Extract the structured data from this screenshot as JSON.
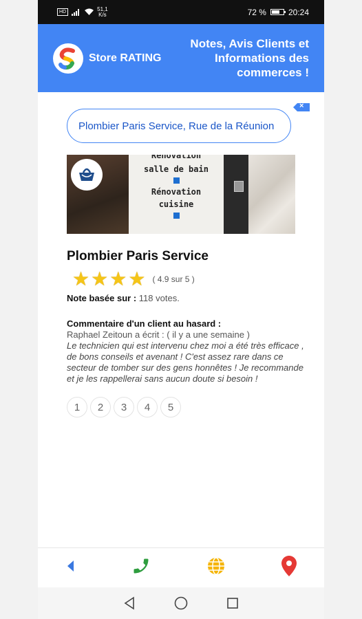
{
  "status_bar": {
    "network_badge": "HD",
    "net_speed_value": "51,1",
    "net_speed_unit": "K/s",
    "battery_percent": "72 %",
    "battery_level": 0.72,
    "time": "20:24"
  },
  "header": {
    "brand_prefix": "Store ",
    "brand_bold": "RATING",
    "tagline": "Notes, Avis Clients et Informations des commerces !"
  },
  "search": {
    "value": "Plombier Paris Service, Rue de la Réunion"
  },
  "hero": {
    "sign_lines": [
      "Rénovation",
      "salle de bain",
      "Rénovation",
      "cuisine"
    ]
  },
  "business": {
    "name": "Plombier Paris Service",
    "stars": 4,
    "rating_text": "( 4.9 sur 5 )",
    "note_label": "Note basée sur :",
    "votes": "118 votes."
  },
  "comment": {
    "title": "Commentaire d'un client au hasard :",
    "author": "Raphael Zeitoun a écrit : ( il y a une semaine )",
    "text": "Le technicien qui est intervenu chez moi a été très efficace , de bons conseils et avenant ! C'est assez rare dans ce secteur de tomber sur des gens honnêtes ! Je recommande et je les rappellerai sans aucun doute si besoin !"
  },
  "pagination": [
    "1",
    "2",
    "3",
    "4",
    "5"
  ],
  "bottom_nav": {
    "back_icon": "arrow-left-icon",
    "phone_icon": "phone-icon",
    "web_icon": "globe-icon",
    "map_icon": "map-pin-icon"
  },
  "colors": {
    "header_bg": "#4285f4",
    "star": "#f5c518",
    "phone": "#2e9d3e",
    "globe": "#f5b400",
    "pin": "#e53935",
    "back": "#3a78e0"
  }
}
